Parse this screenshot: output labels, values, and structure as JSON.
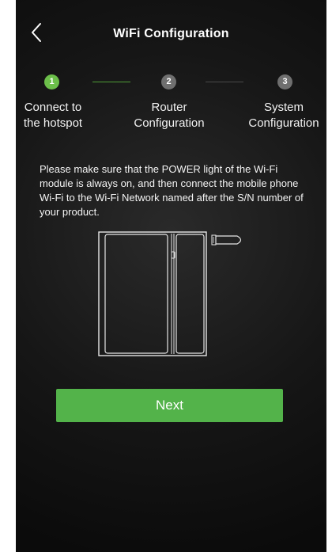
{
  "header": {
    "title": "WiFi Configuration",
    "back_icon": "chevron-left-icon"
  },
  "steps": [
    {
      "number": "1",
      "label": "Connect to\nthe hotspot",
      "active": true
    },
    {
      "number": "2",
      "label": "Router\nConfiguration",
      "active": false
    },
    {
      "number": "3",
      "label": "System\nConfiguration",
      "active": false
    }
  ],
  "instructions": "Please make sure that the POWER light of the Wi-Fi module is always on, and then connect the mobile phone Wi-Fi to the Wi-Fi Network named after the S/N number of your product.",
  "next_label": "Next",
  "colors": {
    "accent": "#53b34a",
    "step_active": "#6cbf4a",
    "step_inactive": "#6f6f6f",
    "background": "#161616"
  }
}
